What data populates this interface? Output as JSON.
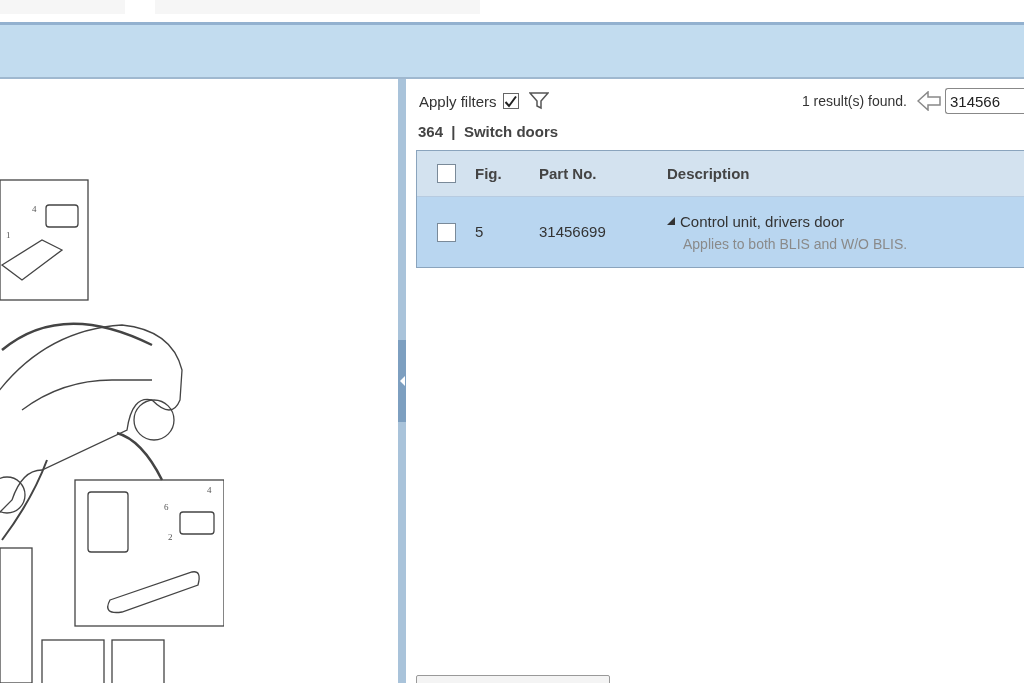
{
  "diagram": {
    "callouts": [
      "4",
      "1",
      "6",
      "4",
      "2"
    ]
  },
  "filter_bar": {
    "apply_filters_label": "Apply filters",
    "apply_filters_checked": true,
    "result_text": "1 result(s) found.",
    "search_value": "314566"
  },
  "group_title": "364  |  Switch doors",
  "table": {
    "header_checked": false,
    "columns": [
      "Fig.",
      "Part No.",
      "Description"
    ],
    "rows": [
      {
        "checked": false,
        "selected": true,
        "expanded": true,
        "fig": "5",
        "part_no": "31456699",
        "description": "Control unit, drivers door",
        "note": "Applies to both BLIS and W/O BLIS."
      }
    ]
  }
}
